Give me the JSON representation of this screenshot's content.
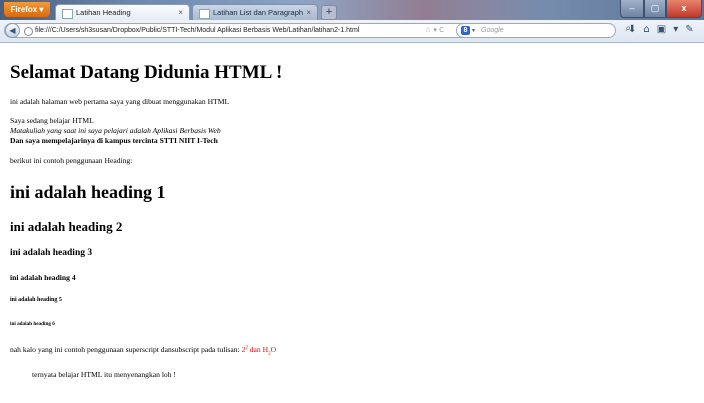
{
  "browser": {
    "app_button": "Firefox ▾",
    "tabs": [
      {
        "label": "Latihan Heading",
        "close": "×"
      },
      {
        "label": "Latihan List dan Paragraph",
        "close": "×"
      }
    ],
    "new_tab": "+",
    "window_controls": {
      "minimize": "–",
      "maximize": "▢",
      "close": "x"
    },
    "url": "file:///C:/Users/sh3susan/Dropbox/Public/STTI-Tech/Modul Aplikasi Berbasis Web/Latihan/latihan2-1.html",
    "url_icons": "☆ ▾ C",
    "search_engine_label": "8",
    "search_placeholder": "Google",
    "toolbar_icons": [
      "⬇",
      "⌂",
      "▣",
      "▾",
      "✎"
    ]
  },
  "page": {
    "title": "Selamat Datang Didunia HTML !",
    "intro": "ini adalah halaman web pertama saya yang dibuat menggunakan HTML",
    "line1": "Saya sedang belajar HTML",
    "line2_italic": "Matakuliah yang saat ini saya pelajari adalah Aplikasi Berbasis Web",
    "line3_bold": "Dan saya mempelajarinya di kampus tercinta STTI NIIT I-Tech",
    "heading_intro": "berikut ini contoh penggunaan Heading:",
    "headings": [
      "ini adalah heading 1",
      "ini adalah heading 2",
      "ini adalah heading 3",
      "ini adalah heading 4",
      "ini adalah heading 5",
      "ini adalah heading 6"
    ],
    "supsub_text": "nah kalo yang ini contoh penggunaan superscript dansubscript pada tulisan: ",
    "sup_base": "2",
    "sup_exp": "2",
    "sub_mid": " dan H",
    "sub_num": "2",
    "sub_end": "O",
    "closing": "ternyata belajar HTML itu menyenangkan loh !"
  },
  "colors": {
    "accent_red": "#e00000"
  }
}
